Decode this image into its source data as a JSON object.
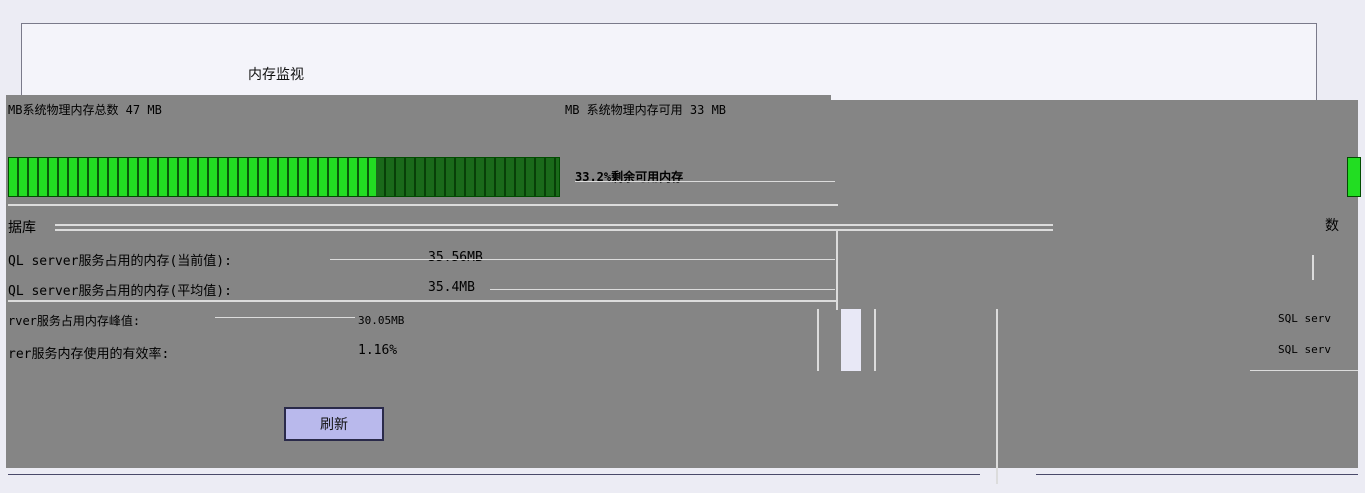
{
  "window": {
    "title": "内存监视"
  },
  "system": {
    "physical_memory_label": "MB系统物理内存总数 47 MB",
    "vm_memory_label": "MB 系统物理内存可用 33 MB"
  },
  "memory_bar": {
    "used_fraction": 0.668,
    "free_label": "33.2%剩余可用内存"
  },
  "database": {
    "section_label": "据库",
    "right_section_label": "数",
    "rows": [
      {
        "label": "QL server服务占用的内存(当前值):",
        "value": "35.56MB"
      },
      {
        "label": "QL server服务占用的内存(平均值):",
        "value": "35.4MB"
      },
      {
        "label": "rver服务占用内存峰值:",
        "value": "30.05MB"
      },
      {
        "label": "rer服务内存使用的有效率:",
        "value": "1.16%"
      }
    ],
    "right_rows": [
      {
        "label": "SQL serv"
      },
      {
        "label": "SQL serv"
      }
    ]
  },
  "actions": {
    "refresh_label": "刷新"
  },
  "colors": {
    "bar_used": "#22dd22",
    "bar_free": "#0a5a0a",
    "panel": "#858585",
    "button": "#b9b9ec"
  }
}
